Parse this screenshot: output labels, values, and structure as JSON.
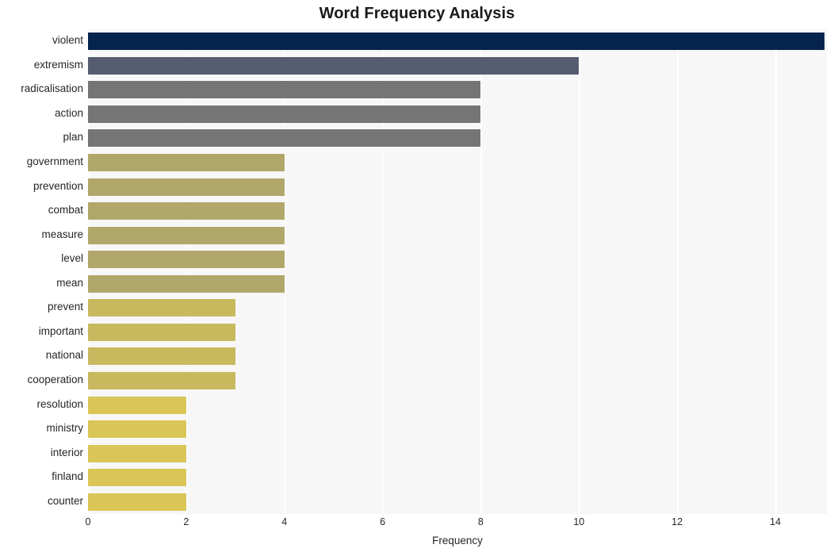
{
  "chart_data": {
    "type": "bar",
    "orientation": "horizontal",
    "title": "Word Frequency Analysis",
    "xlabel": "Frequency",
    "ylabel": "",
    "xlim": [
      0,
      15.05
    ],
    "ylim": [
      0,
      20
    ],
    "xticks": [
      0,
      2,
      4,
      6,
      8,
      10,
      12,
      14
    ],
    "xtick_labels": [
      "0",
      "2",
      "4",
      "6",
      "8",
      "10",
      "12",
      "14"
    ],
    "grid": "vertical-only",
    "legend": "none",
    "categories": [
      "violent",
      "extremism",
      "radicalisation",
      "action",
      "plan",
      "government",
      "prevention",
      "combat",
      "measure",
      "level",
      "mean",
      "prevent",
      "important",
      "national",
      "cooperation",
      "resolution",
      "ministry",
      "interior",
      "finland",
      "counter"
    ],
    "values": [
      15,
      10,
      8,
      8,
      8,
      4,
      4,
      4,
      4,
      4,
      4,
      3,
      3,
      3,
      3,
      2,
      2,
      2,
      2,
      2
    ],
    "bar_colors": [
      "#06244f",
      "#575d70",
      "#757575",
      "#757575",
      "#757575",
      "#b2a76b",
      "#b2a76b",
      "#b2a76b",
      "#b2a76b",
      "#b2a76b",
      "#b2a76b",
      "#c8b95f",
      "#c8b95f",
      "#c8b95f",
      "#c8b95f",
      "#d9c657",
      "#d9c657",
      "#d9c657",
      "#d9c657",
      "#d9c657"
    ],
    "plot_background": "#f7f7f7",
    "figure_background": "#ffffff",
    "gridline_color": "#ffffff",
    "text_color": "#262626",
    "title_color": "#1a1a1a"
  }
}
